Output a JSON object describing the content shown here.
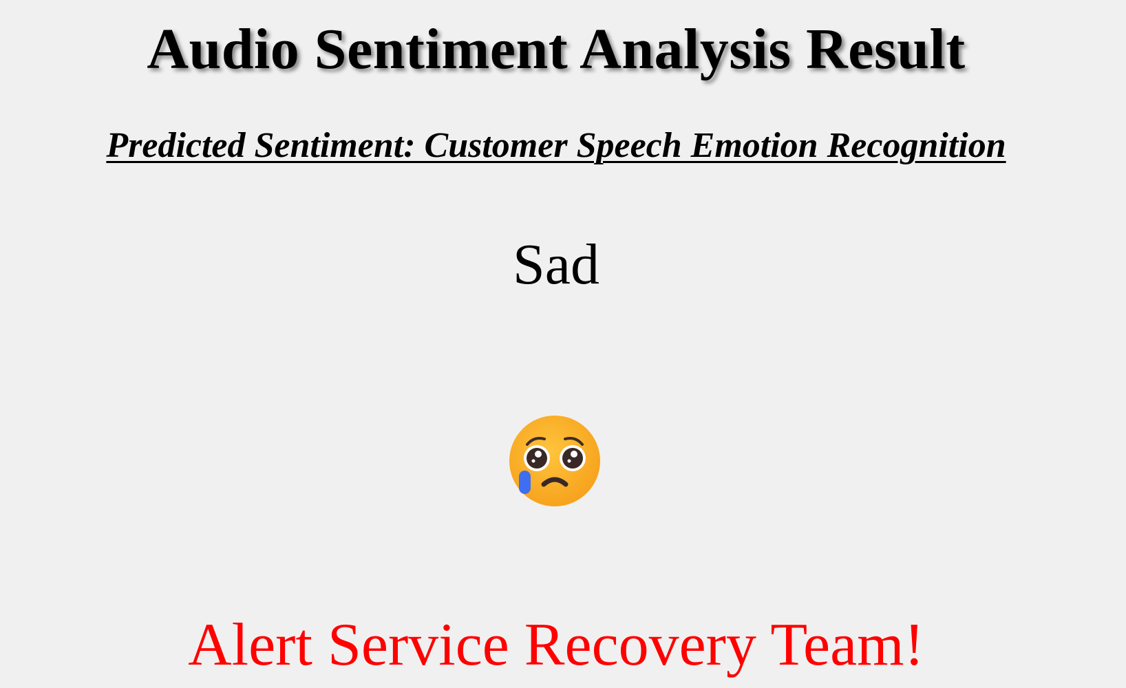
{
  "header": {
    "title": "Audio Sentiment Analysis Result",
    "subtitle": "Predicted Sentiment: Customer Speech Emotion Recognition"
  },
  "result": {
    "sentiment_label": "Sad",
    "emoji_icon": "crying-face-icon",
    "alert_message": "Alert Service Recovery Team!",
    "alert_color": "#ff0000"
  }
}
